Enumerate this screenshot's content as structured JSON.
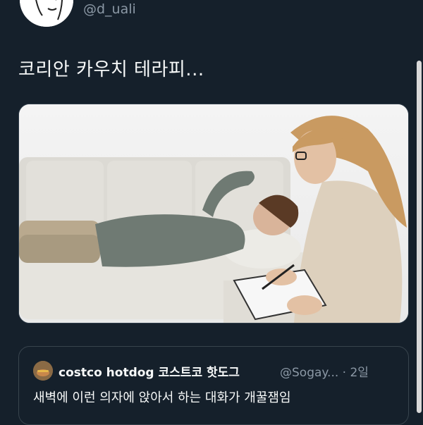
{
  "author": {
    "handle": "@d_uali",
    "avatar_icon": "user-avatar-icon"
  },
  "tweet": {
    "text": "코리안 카우치 테라피..."
  },
  "media": {
    "description_icon": "tweet-photo"
  },
  "quoted": {
    "avatar_icon": "quote-avatar-icon",
    "name": "costco hotdog 코스트코 핫도그",
    "handle_time": "@Sogay... · 2일",
    "text": "새벽에 이런 의자에 앉아서 하는 대화가 개꿀잼임"
  },
  "colors": {
    "background": "#15202b",
    "secondary_text": "#8b98a5",
    "border": "#38444d"
  }
}
